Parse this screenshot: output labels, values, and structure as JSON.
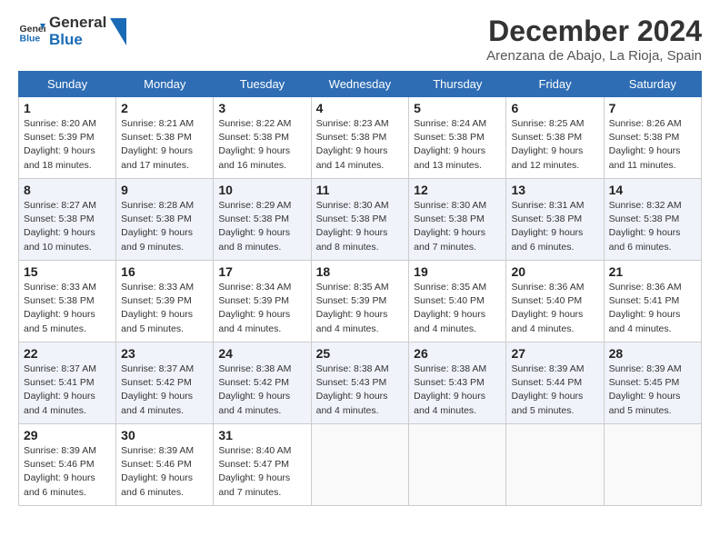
{
  "logo": {
    "text_general": "General",
    "text_blue": "Blue"
  },
  "header": {
    "month_year": "December 2024",
    "location": "Arenzana de Abajo, La Rioja, Spain"
  },
  "weekdays": [
    "Sunday",
    "Monday",
    "Tuesday",
    "Wednesday",
    "Thursday",
    "Friday",
    "Saturday"
  ],
  "weeks": [
    [
      {
        "day": "1",
        "sunrise": "8:20 AM",
        "sunset": "5:39 PM",
        "daylight": "9 hours and 18 minutes."
      },
      {
        "day": "2",
        "sunrise": "8:21 AM",
        "sunset": "5:38 PM",
        "daylight": "9 hours and 17 minutes."
      },
      {
        "day": "3",
        "sunrise": "8:22 AM",
        "sunset": "5:38 PM",
        "daylight": "9 hours and 16 minutes."
      },
      {
        "day": "4",
        "sunrise": "8:23 AM",
        "sunset": "5:38 PM",
        "daylight": "9 hours and 14 minutes."
      },
      {
        "day": "5",
        "sunrise": "8:24 AM",
        "sunset": "5:38 PM",
        "daylight": "9 hours and 13 minutes."
      },
      {
        "day": "6",
        "sunrise": "8:25 AM",
        "sunset": "5:38 PM",
        "daylight": "9 hours and 12 minutes."
      },
      {
        "day": "7",
        "sunrise": "8:26 AM",
        "sunset": "5:38 PM",
        "daylight": "9 hours and 11 minutes."
      }
    ],
    [
      {
        "day": "8",
        "sunrise": "8:27 AM",
        "sunset": "5:38 PM",
        "daylight": "9 hours and 10 minutes."
      },
      {
        "day": "9",
        "sunrise": "8:28 AM",
        "sunset": "5:38 PM",
        "daylight": "9 hours and 9 minutes."
      },
      {
        "day": "10",
        "sunrise": "8:29 AM",
        "sunset": "5:38 PM",
        "daylight": "9 hours and 8 minutes."
      },
      {
        "day": "11",
        "sunrise": "8:30 AM",
        "sunset": "5:38 PM",
        "daylight": "9 hours and 8 minutes."
      },
      {
        "day": "12",
        "sunrise": "8:30 AM",
        "sunset": "5:38 PM",
        "daylight": "9 hours and 7 minutes."
      },
      {
        "day": "13",
        "sunrise": "8:31 AM",
        "sunset": "5:38 PM",
        "daylight": "9 hours and 6 minutes."
      },
      {
        "day": "14",
        "sunrise": "8:32 AM",
        "sunset": "5:38 PM",
        "daylight": "9 hours and 6 minutes."
      }
    ],
    [
      {
        "day": "15",
        "sunrise": "8:33 AM",
        "sunset": "5:38 PM",
        "daylight": "9 hours and 5 minutes."
      },
      {
        "day": "16",
        "sunrise": "8:33 AM",
        "sunset": "5:39 PM",
        "daylight": "9 hours and 5 minutes."
      },
      {
        "day": "17",
        "sunrise": "8:34 AM",
        "sunset": "5:39 PM",
        "daylight": "9 hours and 4 minutes."
      },
      {
        "day": "18",
        "sunrise": "8:35 AM",
        "sunset": "5:39 PM",
        "daylight": "9 hours and 4 minutes."
      },
      {
        "day": "19",
        "sunrise": "8:35 AM",
        "sunset": "5:40 PM",
        "daylight": "9 hours and 4 minutes."
      },
      {
        "day": "20",
        "sunrise": "8:36 AM",
        "sunset": "5:40 PM",
        "daylight": "9 hours and 4 minutes."
      },
      {
        "day": "21",
        "sunrise": "8:36 AM",
        "sunset": "5:41 PM",
        "daylight": "9 hours and 4 minutes."
      }
    ],
    [
      {
        "day": "22",
        "sunrise": "8:37 AM",
        "sunset": "5:41 PM",
        "daylight": "9 hours and 4 minutes."
      },
      {
        "day": "23",
        "sunrise": "8:37 AM",
        "sunset": "5:42 PM",
        "daylight": "9 hours and 4 minutes."
      },
      {
        "day": "24",
        "sunrise": "8:38 AM",
        "sunset": "5:42 PM",
        "daylight": "9 hours and 4 minutes."
      },
      {
        "day": "25",
        "sunrise": "8:38 AM",
        "sunset": "5:43 PM",
        "daylight": "9 hours and 4 minutes."
      },
      {
        "day": "26",
        "sunrise": "8:38 AM",
        "sunset": "5:43 PM",
        "daylight": "9 hours and 4 minutes."
      },
      {
        "day": "27",
        "sunrise": "8:39 AM",
        "sunset": "5:44 PM",
        "daylight": "9 hours and 5 minutes."
      },
      {
        "day": "28",
        "sunrise": "8:39 AM",
        "sunset": "5:45 PM",
        "daylight": "9 hours and 5 minutes."
      }
    ],
    [
      {
        "day": "29",
        "sunrise": "8:39 AM",
        "sunset": "5:46 PM",
        "daylight": "9 hours and 6 minutes."
      },
      {
        "day": "30",
        "sunrise": "8:39 AM",
        "sunset": "5:46 PM",
        "daylight": "9 hours and 6 minutes."
      },
      {
        "day": "31",
        "sunrise": "8:40 AM",
        "sunset": "5:47 PM",
        "daylight": "9 hours and 7 minutes."
      },
      null,
      null,
      null,
      null
    ]
  ],
  "labels": {
    "sunrise": "Sunrise:",
    "sunset": "Sunset:",
    "daylight": "Daylight:"
  }
}
